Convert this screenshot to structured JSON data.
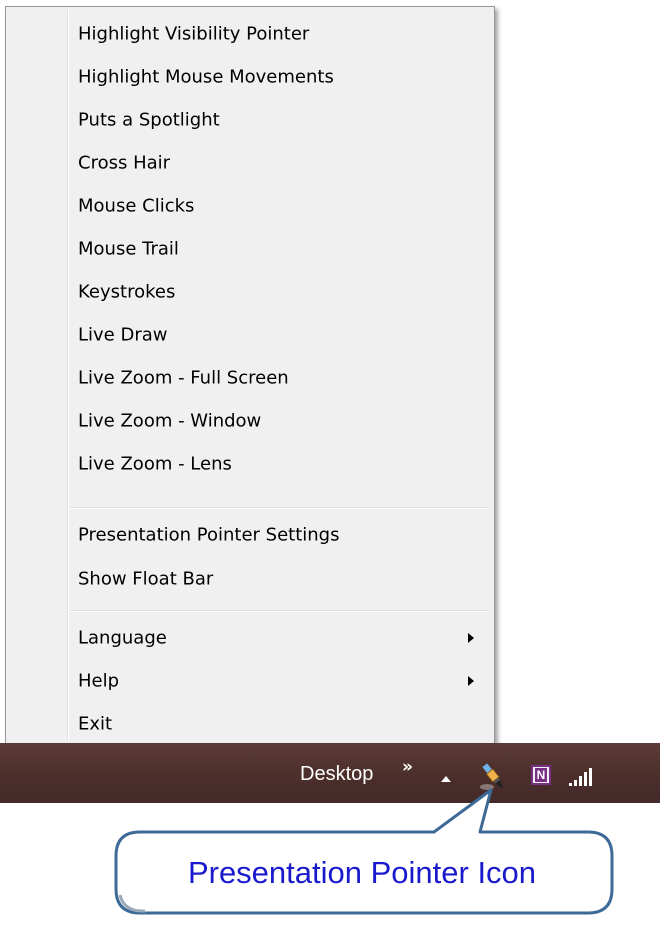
{
  "menu": {
    "items": [
      {
        "label": "Highlight Visibility Pointer"
      },
      {
        "label": "Highlight Mouse Movements"
      },
      {
        "label": "Puts a Spotlight"
      },
      {
        "label": "Cross Hair"
      },
      {
        "label": "Mouse Clicks"
      },
      {
        "label": "Mouse Trail"
      },
      {
        "label": "Keystrokes"
      },
      {
        "label": "Live Draw"
      },
      {
        "label": "Live Zoom - Full Screen"
      },
      {
        "label": "Live Zoom - Window"
      },
      {
        "label": "Live Zoom - Lens"
      }
    ],
    "settings_items": [
      {
        "label": "Presentation Pointer Settings"
      },
      {
        "label": "Show Float Bar"
      }
    ],
    "system_items": [
      {
        "label": "Language",
        "submenu": true
      },
      {
        "label": "Help",
        "submenu": true
      },
      {
        "label": "Exit",
        "submenu": false
      }
    ]
  },
  "taskbar": {
    "desktop_label": "Desktop",
    "chevron": "»",
    "tray_icons": [
      "show-hidden-icons-arrow-icon",
      "presentation-pointer-icon",
      "onenote-icon",
      "network-signal-icon"
    ],
    "onenote_letter": "N"
  },
  "callout": {
    "text": "Presentation Pointer Icon",
    "text_color": "#1a1acc",
    "border_color": "#3d6a96"
  },
  "colors": {
    "menu_background": "#f0f0f0",
    "taskbar": "#4e302c"
  }
}
